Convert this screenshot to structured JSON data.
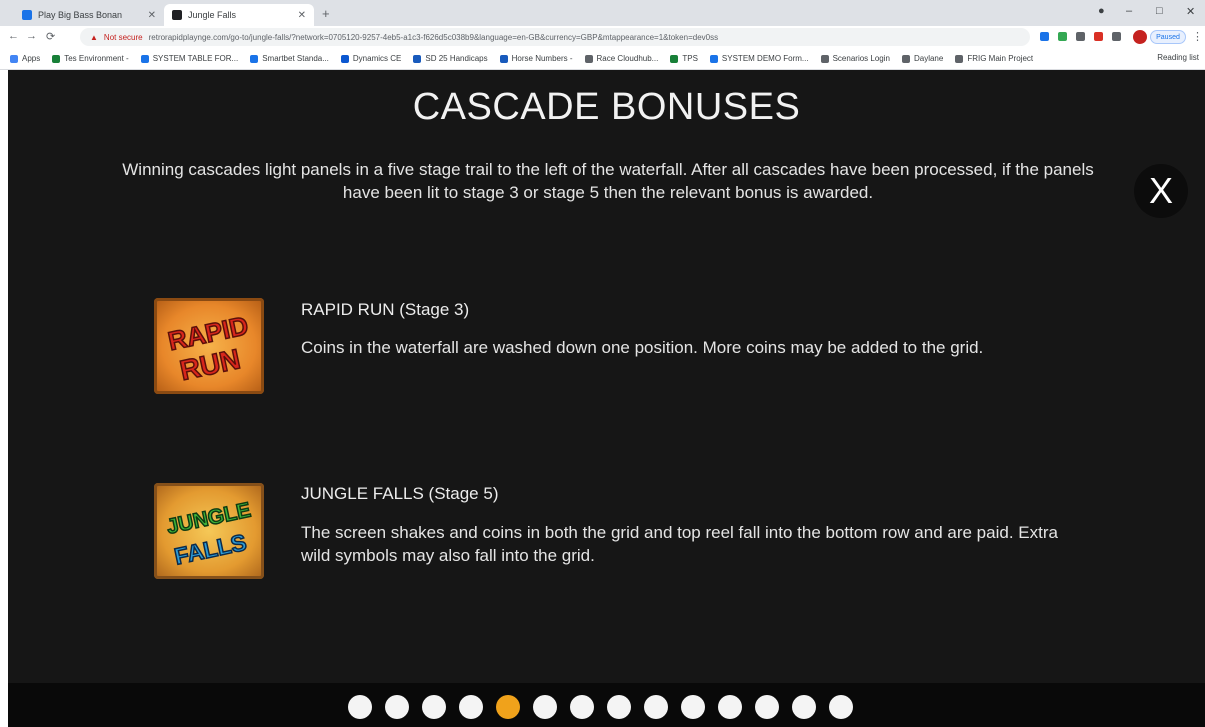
{
  "browser": {
    "tabs": [
      {
        "title": "Play Big Bass Bonan",
        "favicon_color": "#1a73e8",
        "active": false
      },
      {
        "title": "Jungle Falls",
        "favicon_color": "#202124",
        "active": true
      }
    ],
    "new_tab": "+",
    "window_controls": {
      "minimize": "–",
      "maximize": "□",
      "close": "✕"
    },
    "nav": {
      "back": "←",
      "forward": "→",
      "reload": "⟳"
    },
    "security_label": "Not secure",
    "url": "retrorapidplaynge.com/go-to/jungle-falls/?network=0705120-9257-4eb5-a1c3-f626d5c038b9&language=en-GB&currency=GBP&mtappearance=1&token=dev0ss",
    "extensions": [
      "#1a73e8",
      "#34a853",
      "#5f6368",
      "#d93025"
    ],
    "profile_pause": "Paused",
    "kebab": "⋮",
    "bookmarks": [
      {
        "label": "Apps",
        "color": "#4285f4"
      },
      {
        "label": "Tes Environment -",
        "color": "#188038"
      },
      {
        "label": "SYSTEM TABLE FOR...",
        "color": "#1a73e8"
      },
      {
        "label": "Smartbet Standa...",
        "color": "#1a73e8"
      },
      {
        "label": "Dynamics CE",
        "color": "#0b57d0"
      },
      {
        "label": "SD 25 Handicaps",
        "color": "#185abc"
      },
      {
        "label": "Horse Numbers -",
        "color": "#185abc"
      },
      {
        "label": "Race Cloudhub...",
        "color": "#5f6368"
      },
      {
        "label": "TPS",
        "color": "#188038"
      },
      {
        "label": "SYSTEM DEMO Form...",
        "color": "#1a73e8"
      },
      {
        "label": "Scenarios Login",
        "color": "#5f6368"
      },
      {
        "label": "Daylane",
        "color": "#5f6368"
      },
      {
        "label": "FRIG Main Project",
        "color": "#5f6368"
      }
    ],
    "reading_list": "Reading list"
  },
  "game": {
    "title": "CASCADE BONUSES",
    "intro": "Winning cascades light panels in a five stage trail to the left of the waterfall. After all cascades have been processed, if the panels have been lit to stage 3 or stage 5 then the relevant bonus is awarded.",
    "close_label": "X",
    "bonuses": [
      {
        "name": "RAPID RUN (Stage 3)",
        "description": "Coins in the waterfall are washed down one position. More coins may be added to the grid.",
        "icon_words": [
          "RAPID",
          "RUN"
        ],
        "icon_text_color": "#d8261c"
      },
      {
        "name": "JUNGLE FALLS (Stage 5)",
        "description": "The screen shakes and coins in both the grid and top reel fall into the bottom row and are paid. Extra wild symbols may also fall into the grid.",
        "icon_words": [
          "JUNGLE",
          "FALLS"
        ],
        "icon_text_colors": [
          "#3fb43a",
          "#2c9bd6"
        ]
      }
    ],
    "pagination": {
      "total": 14,
      "active_index": 4,
      "dot_color": "#f4f4f4",
      "active_color": "#f0a21b"
    }
  }
}
